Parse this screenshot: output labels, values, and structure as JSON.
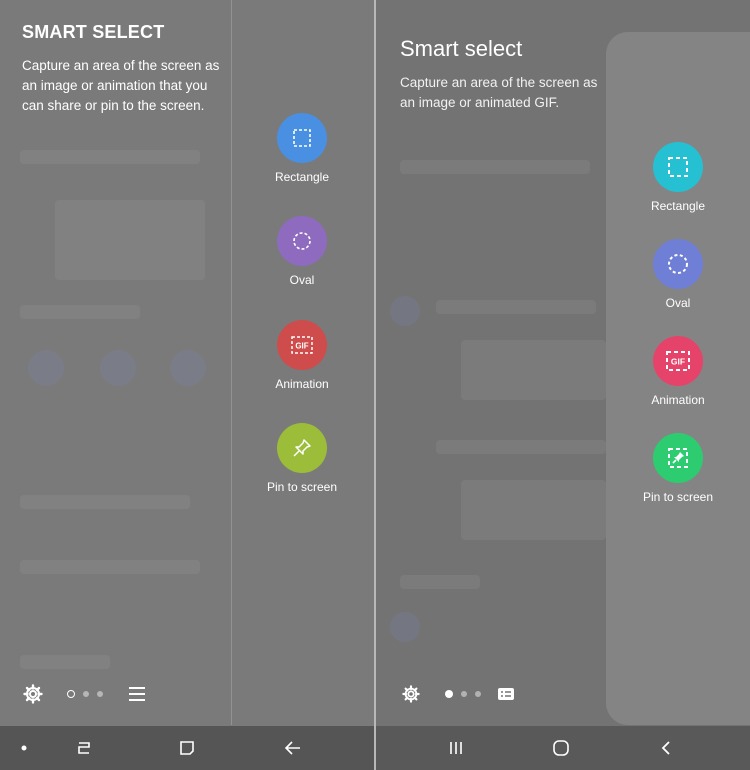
{
  "left": {
    "title": "SMART SELECT",
    "description": "Capture an area of the screen as an image or animation that you can share or pin to the screen.",
    "tools": [
      {
        "label": "Rectangle",
        "color": "#4a90e2",
        "icon": "rectangle-select-icon"
      },
      {
        "label": "Oval",
        "color": "#8e6bbf",
        "icon": "oval-select-icon"
      },
      {
        "label": "Animation",
        "color": "#cf4c4c",
        "icon": "gif-animation-icon"
      },
      {
        "label": "Pin to screen",
        "color": "#9bbd3a",
        "icon": "pin-icon"
      }
    ]
  },
  "right": {
    "title": "Smart select",
    "description": "Capture an area of the screen as an image or animated GIF.",
    "tools": [
      {
        "label": "Rectangle",
        "color": "#26c0d3",
        "icon": "rectangle-select-icon"
      },
      {
        "label": "Oval",
        "color": "#6f7fd6",
        "icon": "oval-select-icon"
      },
      {
        "label": "Animation",
        "color": "#e6436a",
        "icon": "gif-animation-icon"
      },
      {
        "label": "Pin to screen",
        "color": "#2ecc71",
        "icon": "pin-icon"
      }
    ]
  },
  "gif_text": "GIF"
}
